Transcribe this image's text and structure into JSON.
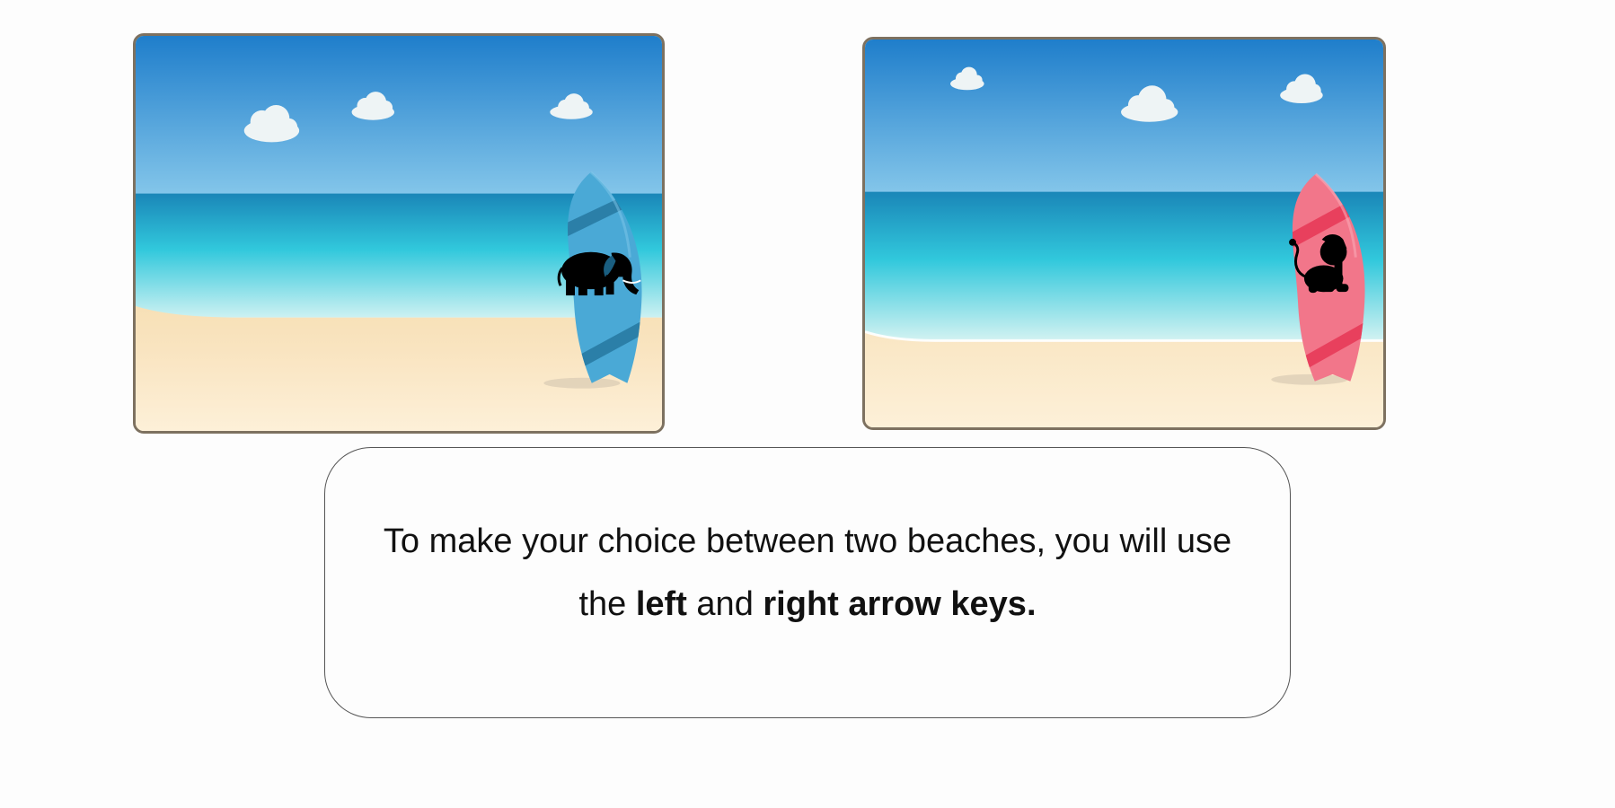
{
  "beaches": [
    {
      "id": "left",
      "board_color": "#4aa9d6",
      "stripe_color": "#2b7fa8",
      "animal_icon": "elephant-icon"
    },
    {
      "id": "right",
      "board_color": "#f2768a",
      "stripe_color": "#e8405d",
      "animal_icon": "lion-icon"
    }
  ],
  "instruction": {
    "part1": "To make your choice between two beaches, you will use the",
    "part2": "left",
    "part3": "and",
    "part4": "right arrow keys."
  },
  "colors": {
    "sky_top": "#1f7ecb",
    "sky_bottom": "#84c6ea",
    "sea": "#31c8dc",
    "sand": "#fdf0d8",
    "card_border": "#7d7160"
  }
}
